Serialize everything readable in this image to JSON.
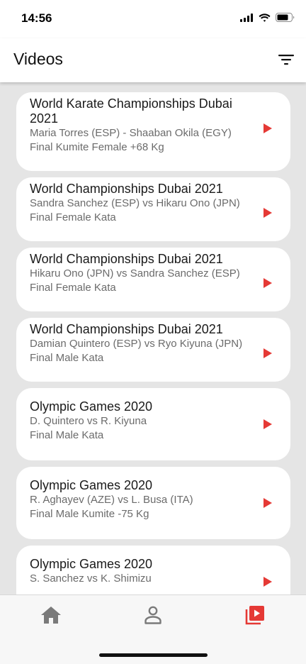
{
  "status_bar": {
    "time": "14:56",
    "icons": [
      "cellular-signal-icon",
      "wifi-icon",
      "battery-icon"
    ]
  },
  "app_bar": {
    "title": "Videos",
    "filter_icon": "filter-icon"
  },
  "colors": {
    "accent": "#e53935",
    "list_background": "#e5e5e5",
    "card_background": "#ffffff",
    "inactive_nav": "#7a7a7a"
  },
  "videos": [
    {
      "title": "World Karate Championships Dubai 2021",
      "players": "Maria Torres (ESP) - Shaaban Okila (EGY)",
      "event": "Final Kumite Female +68 Kg"
    },
    {
      "title": "World Championships Dubai 2021",
      "players": "Sandra Sanchez (ESP) vs Hikaru Ono (JPN)",
      "event": "Final Female Kata"
    },
    {
      "title": "World Championships Dubai 2021",
      "players": "Hikaru Ono (JPN) vs Sandra Sanchez (ESP)",
      "event": "Final Female Kata"
    },
    {
      "title": "World Championships Dubai 2021",
      "players": "Damian Quintero (ESP) vs Ryo Kiyuna (JPN)",
      "event": "Final Male Kata"
    },
    {
      "title": "Olympic Games 2020",
      "players": "D. Quintero vs R. Kiyuna",
      "event": "Final Male Kata"
    },
    {
      "title": "Olympic Games 2020",
      "players": "R. Aghayev (AZE) vs L. Busa (ITA)",
      "event": "Final Male Kumite -75 Kg"
    },
    {
      "title": "Olympic Games 2020",
      "players": "S. Sanchez vs K. Shimizu",
      "event": ""
    }
  ],
  "bottom_nav": {
    "items": [
      {
        "icon": "home-icon",
        "active": false
      },
      {
        "icon": "person-icon",
        "active": false
      },
      {
        "icon": "video-library-icon",
        "active": true
      }
    ]
  }
}
